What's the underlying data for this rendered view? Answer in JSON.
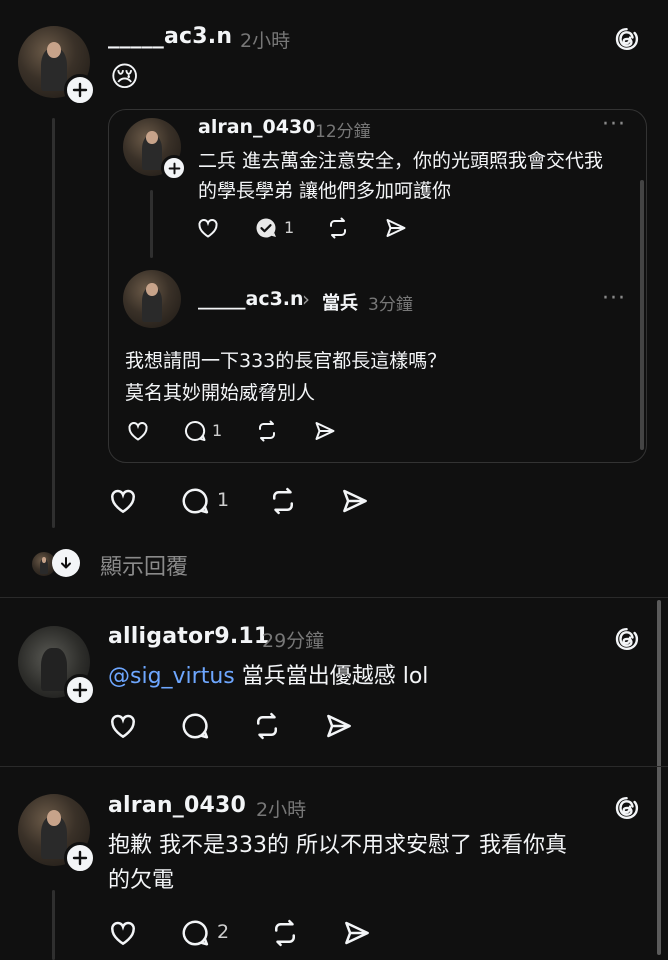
{
  "post1": {
    "username": "_____ac3.n",
    "time": "2小時",
    "emoji": "😢",
    "actions": {
      "reply_count": "1"
    },
    "show_replies_label": "顯示回覆"
  },
  "quote1": {
    "username": "alran_0430",
    "time": "12分鐘",
    "more": "···",
    "text_line1": "二兵 進去萬金注意安全，你的光頭照我會交代我",
    "text_line2": "的學長學弟 讓他們多加呵護你",
    "reply_count": "1"
  },
  "quote2": {
    "username": "_____ac3.n",
    "arrow": "›",
    "reply_to": "當兵",
    "time": "3分鐘",
    "more": "···",
    "text_line1": "我想請問一下333的長官都長這樣嗎？",
    "text_line2": "莫名其妙開始威脅別人",
    "reply_count": "1"
  },
  "post2": {
    "username": "alligator9.11",
    "time": "29分鐘",
    "mention": "@sig_virtus",
    "text": " 當兵當出優越感 lol"
  },
  "post3": {
    "username": "alran_0430",
    "time": "2小時",
    "text_line1": "抱歉 我不是333的 所以不用求安慰了 我看你真",
    "text_line2": "的欠電",
    "reply_count": "2"
  },
  "icons": {
    "threads": "threads-logo-icon",
    "like": "heart-icon",
    "comment": "comment-icon",
    "repost": "repost-icon",
    "share": "send-icon",
    "follow": "plus-icon"
  }
}
